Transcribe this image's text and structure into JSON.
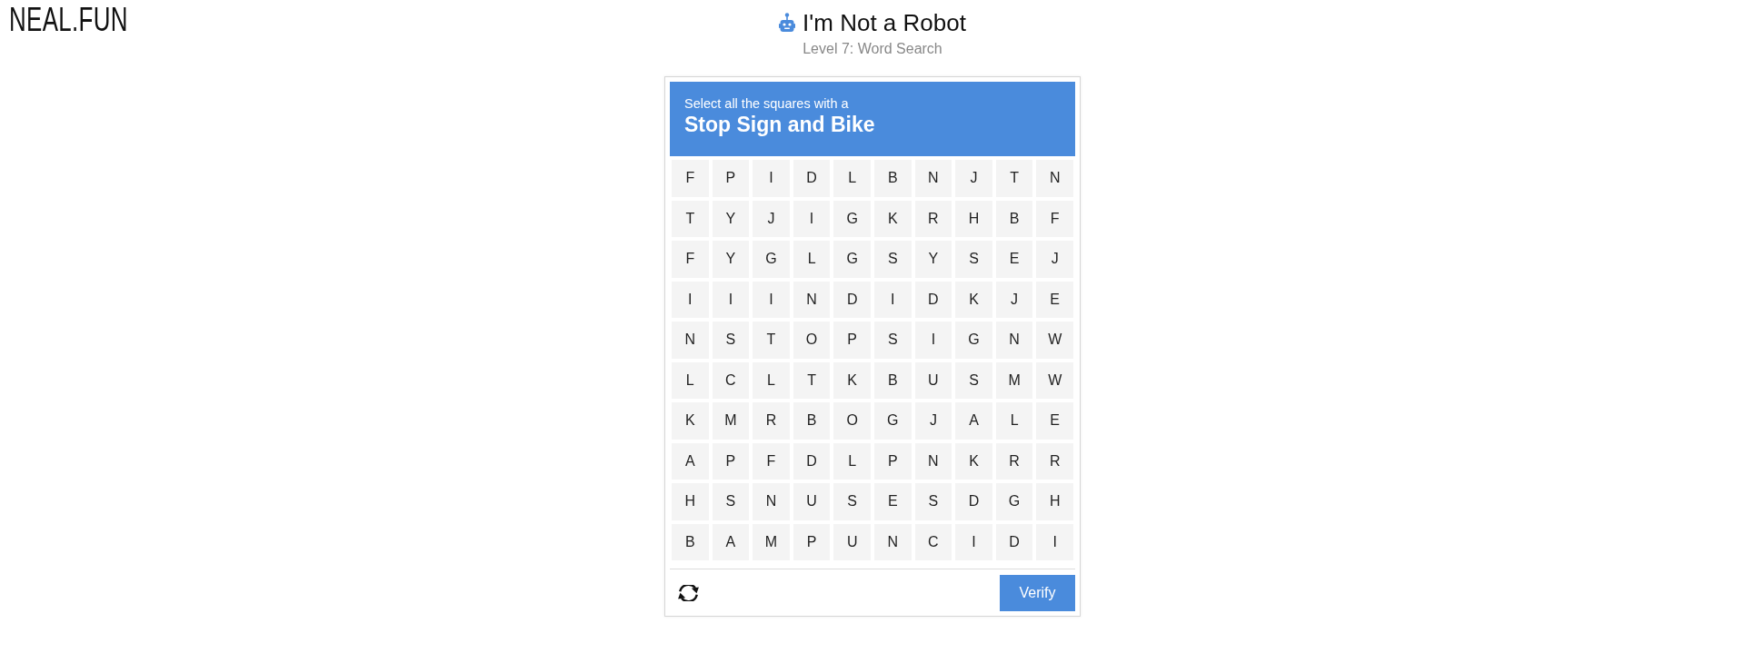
{
  "logo": "NEAL.FUN",
  "header": {
    "title": "I'm Not a Robot",
    "subtitle": "Level 7: Word Search"
  },
  "challenge": {
    "instruction": "Select all the squares with a",
    "target": "Stop Sign and Bike"
  },
  "grid": {
    "rows": [
      [
        {
          "letter": "F",
          "selected": false
        },
        {
          "letter": "P",
          "selected": false
        },
        {
          "letter": "I",
          "selected": false
        },
        {
          "letter": "D",
          "selected": false
        },
        {
          "letter": "L",
          "selected": false
        },
        {
          "letter": "B",
          "selected": false
        },
        {
          "letter": "N",
          "selected": false
        },
        {
          "letter": "J",
          "selected": false
        },
        {
          "letter": "T",
          "selected": false
        },
        {
          "letter": "N",
          "selected": false
        }
      ],
      [
        {
          "letter": "T",
          "selected": false
        },
        {
          "letter": "Y",
          "selected": false
        },
        {
          "letter": "J",
          "selected": false
        },
        {
          "letter": "I",
          "selected": false
        },
        {
          "letter": "G",
          "selected": false
        },
        {
          "letter": "K",
          "selected": false
        },
        {
          "letter": "R",
          "selected": false
        },
        {
          "letter": "H",
          "selected": false
        },
        {
          "letter": "B",
          "selected": false
        },
        {
          "letter": "F",
          "selected": false
        }
      ],
      [
        {
          "letter": "F",
          "selected": false
        },
        {
          "letter": "Y",
          "selected": false
        },
        {
          "letter": "G",
          "selected": false
        },
        {
          "letter": "L",
          "selected": false
        },
        {
          "letter": "G",
          "selected": false
        },
        {
          "letter": "S",
          "selected": false
        },
        {
          "letter": "Y",
          "selected": false
        },
        {
          "letter": "S",
          "selected": false
        },
        {
          "letter": "E",
          "selected": false
        },
        {
          "letter": "J",
          "selected": false
        }
      ],
      [
        {
          "letter": "I",
          "selected": false
        },
        {
          "letter": "I",
          "selected": false
        },
        {
          "letter": "I",
          "selected": false
        },
        {
          "letter": "N",
          "selected": false
        },
        {
          "letter": "D",
          "selected": false
        },
        {
          "letter": "I",
          "selected": false
        },
        {
          "letter": "D",
          "selected": false
        },
        {
          "letter": "K",
          "selected": false
        },
        {
          "letter": "J",
          "selected": false
        },
        {
          "letter": "E",
          "selected": false
        }
      ],
      [
        {
          "letter": "N",
          "selected": false
        },
        {
          "letter": "S",
          "selected": false
        },
        {
          "letter": "T",
          "selected": false
        },
        {
          "letter": "O",
          "selected": false
        },
        {
          "letter": "P",
          "selected": false
        },
        {
          "letter": "S",
          "selected": false
        },
        {
          "letter": "I",
          "selected": false
        },
        {
          "letter": "G",
          "selected": false
        },
        {
          "letter": "N",
          "selected": false
        },
        {
          "letter": "W",
          "selected": false
        }
      ],
      [
        {
          "letter": "L",
          "selected": false
        },
        {
          "letter": "C",
          "selected": false
        },
        {
          "letter": "L",
          "selected": false
        },
        {
          "letter": "T",
          "selected": false
        },
        {
          "letter": "K",
          "selected": false
        },
        {
          "letter": "B",
          "selected": false
        },
        {
          "letter": "U",
          "selected": false
        },
        {
          "letter": "S",
          "selected": false
        },
        {
          "letter": "M",
          "selected": false
        },
        {
          "letter": "W",
          "selected": false
        }
      ],
      [
        {
          "letter": "K",
          "selected": false
        },
        {
          "letter": "M",
          "selected": false
        },
        {
          "letter": "R",
          "selected": false
        },
        {
          "letter": "B",
          "selected": false
        },
        {
          "letter": "O",
          "selected": false
        },
        {
          "letter": "G",
          "selected": false
        },
        {
          "letter": "J",
          "selected": false
        },
        {
          "letter": "A",
          "selected": false
        },
        {
          "letter": "L",
          "selected": false
        },
        {
          "letter": "E",
          "selected": false
        }
      ],
      [
        {
          "letter": "A",
          "selected": false
        },
        {
          "letter": "P",
          "selected": false
        },
        {
          "letter": "F",
          "selected": false
        },
        {
          "letter": "D",
          "selected": false
        },
        {
          "letter": "L",
          "selected": false
        },
        {
          "letter": "P",
          "selected": false
        },
        {
          "letter": "N",
          "selected": false
        },
        {
          "letter": "K",
          "selected": false
        },
        {
          "letter": "R",
          "selected": false
        },
        {
          "letter": "R",
          "selected": false
        }
      ],
      [
        {
          "letter": "H",
          "selected": false
        },
        {
          "letter": "S",
          "selected": false
        },
        {
          "letter": "N",
          "selected": false
        },
        {
          "letter": "U",
          "selected": false
        },
        {
          "letter": "S",
          "selected": false
        },
        {
          "letter": "E",
          "selected": false
        },
        {
          "letter": "S",
          "selected": false
        },
        {
          "letter": "D",
          "selected": false
        },
        {
          "letter": "G",
          "selected": false
        },
        {
          "letter": "H",
          "selected": false
        }
      ],
      [
        {
          "letter": "B",
          "selected": false
        },
        {
          "letter": "A",
          "selected": false
        },
        {
          "letter": "M",
          "selected": false
        },
        {
          "letter": "P",
          "selected": false
        },
        {
          "letter": "U",
          "selected": false
        },
        {
          "letter": "N",
          "selected": false
        },
        {
          "letter": "C",
          "selected": false
        },
        {
          "letter": "I",
          "selected": false
        },
        {
          "letter": "D",
          "selected": false
        },
        {
          "letter": "I",
          "selected": false
        }
      ]
    ]
  },
  "footer": {
    "verify_button": "Verify"
  }
}
